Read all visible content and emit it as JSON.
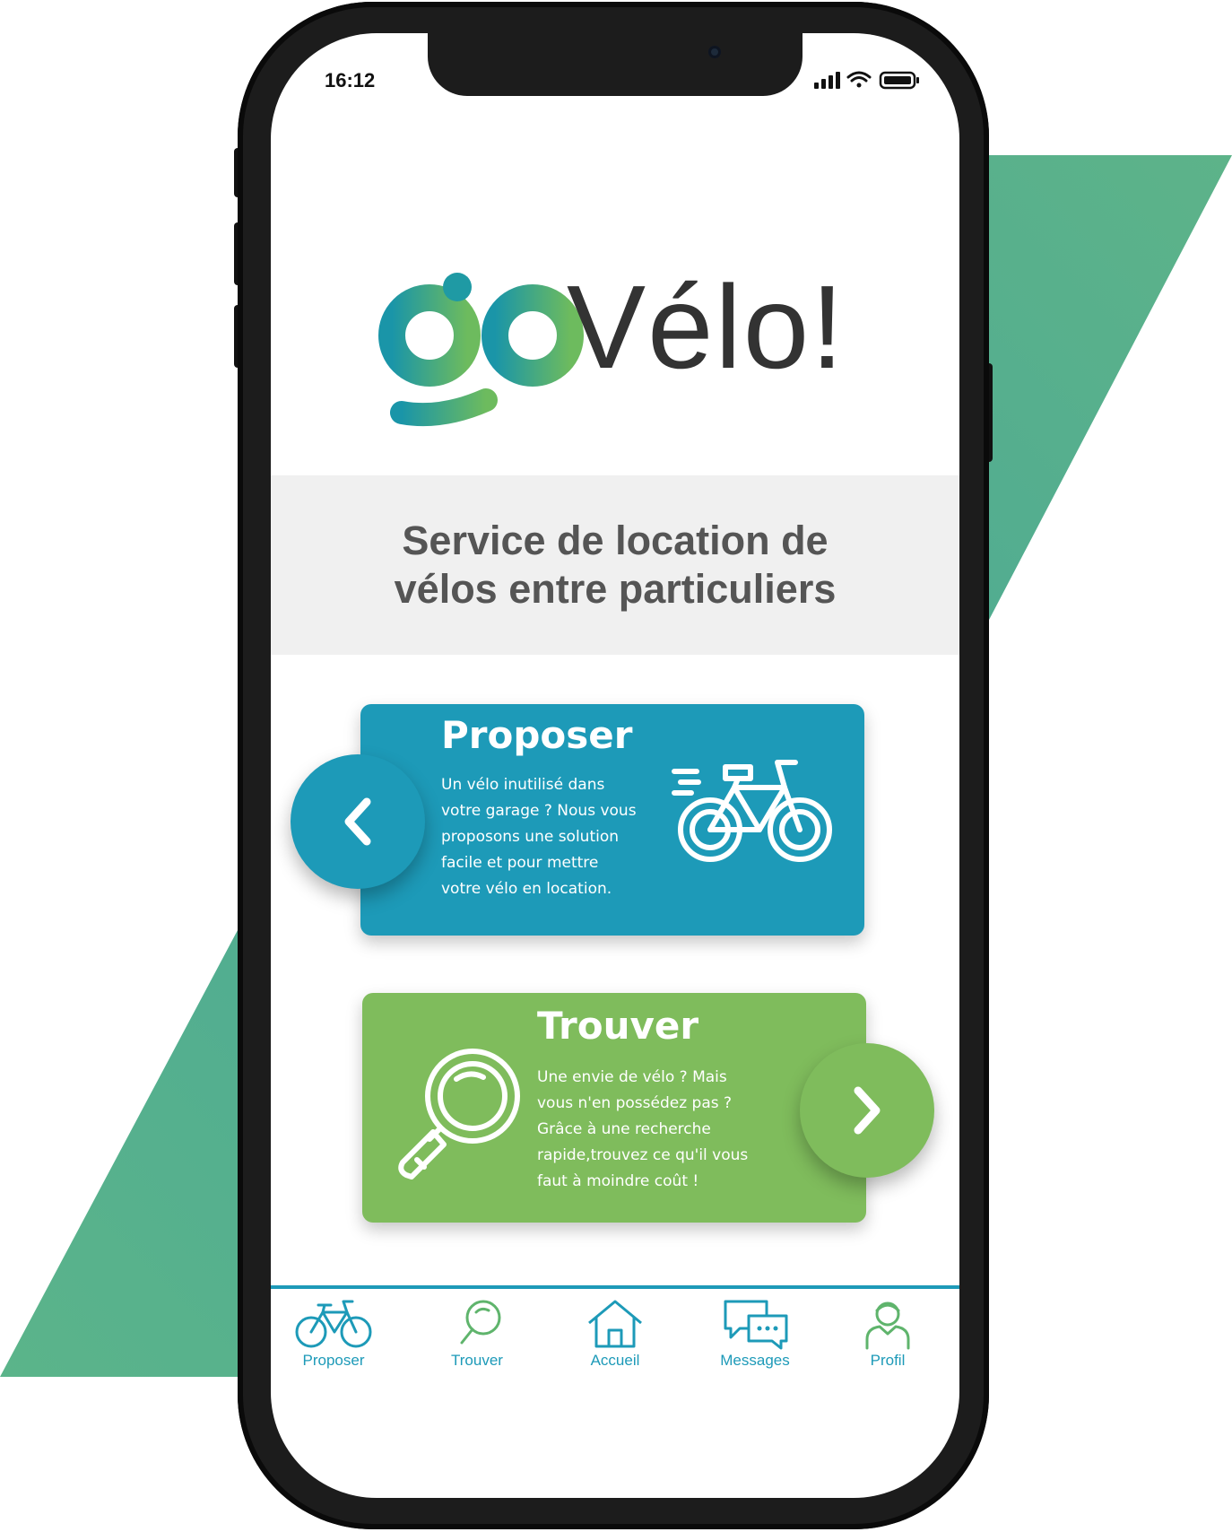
{
  "status_bar": {
    "time": "16:12"
  },
  "logo": {
    "go_text": "go",
    "velo_text": "Vélo!"
  },
  "tagline": {
    "line1": "Service de location de",
    "line2": "vélos entre particuliers"
  },
  "cards": {
    "proposer": {
      "title": "Proposer",
      "description": "Un vélo inutilisé dans\nvotre garage ? Nous vous\nproposons une solution\nfacile et  pour mettre\nvotre vélo en location."
    },
    "trouver": {
      "title": "Trouver",
      "description": "Une envie de vélo ? Mais\nvous n'en possédez pas ?\nGrâce à une recherche\nrapide,trouvez ce qu'il vous\nfaut à moindre coût !"
    }
  },
  "bottom_nav": {
    "items": [
      {
        "label": "Proposer",
        "icon": "bicycle-icon"
      },
      {
        "label": "Trouver",
        "icon": "search-icon"
      },
      {
        "label": "Accueil",
        "icon": "home-icon"
      },
      {
        "label": "Messages",
        "icon": "messages-icon"
      },
      {
        "label": "Profil",
        "icon": "profile-icon"
      }
    ]
  },
  "colors": {
    "teal": "#1d9ab8",
    "green": "#7fbc5c",
    "logo_gradient_start": "#1a95a8",
    "logo_gradient_end": "#6dbb5e",
    "background_shape": "#4fae90"
  }
}
